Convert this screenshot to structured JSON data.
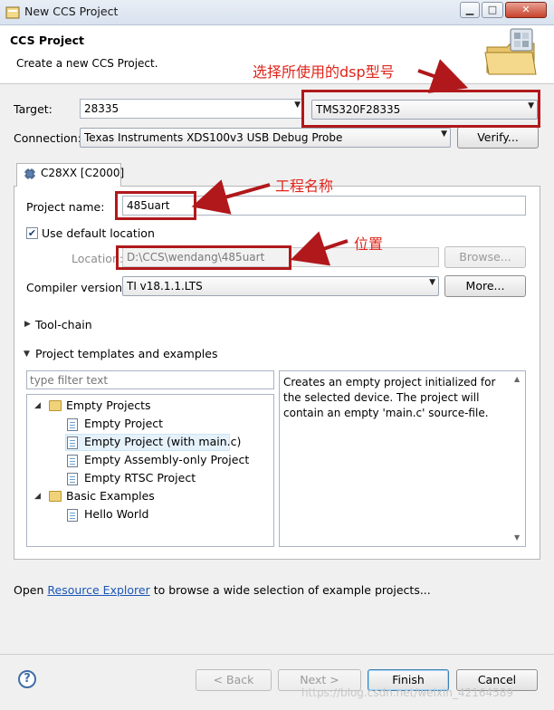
{
  "window": {
    "title": "New CCS Project",
    "buttons": {
      "minimize": "▁",
      "maximize": "□",
      "close": "✕"
    }
  },
  "header": {
    "title": "CCS Project",
    "subtitle": "Create a new CCS Project."
  },
  "form": {
    "target_label": "Target:",
    "target_family_value": "28335",
    "target_device_value": "TMS320F28335",
    "connection_label": "Connection:",
    "connection_value": "Texas Instruments XDS100v3 USB Debug Probe",
    "verify_button": "Verify..."
  },
  "tab": {
    "label": "C28XX [C2000]"
  },
  "project": {
    "name_label": "Project name:",
    "name_value": "485uart",
    "use_default_location_label": "Use default location",
    "use_default_location_checked": true,
    "location_label": "Location:",
    "location_value": "D:\\CCS\\wendang\\485uart",
    "browse_button": "Browse...",
    "compiler_label": "Compiler version:",
    "compiler_value": "TI v18.1.1.LTS",
    "more_button": "More..."
  },
  "sections": {
    "toolchain": "Tool-chain",
    "templates": "Project templates and examples"
  },
  "templates": {
    "filter_placeholder": "type filter text",
    "tree": [
      {
        "label": "Empty Projects",
        "level": 0,
        "type": "folder",
        "expanded": true
      },
      {
        "label": "Empty Project",
        "level": 1,
        "type": "file"
      },
      {
        "label": "Empty Project (with main.c)",
        "level": 1,
        "type": "file",
        "selected": true
      },
      {
        "label": "Empty Assembly-only Project",
        "level": 1,
        "type": "file"
      },
      {
        "label": "Empty RTSC Project",
        "level": 1,
        "type": "file"
      },
      {
        "label": "Basic Examples",
        "level": 0,
        "type": "folder",
        "expanded": true
      },
      {
        "label": "Hello World",
        "level": 1,
        "type": "file"
      }
    ],
    "description": "Creates an empty project initialized for the selected device. The project will contain an empty 'main.c' source-file."
  },
  "resource": {
    "prefix": "Open ",
    "link": "Resource Explorer",
    "suffix": " to browse a wide selection of example projects..."
  },
  "footer": {
    "help": "?",
    "back": "< Back",
    "next": "Next >",
    "finish": "Finish",
    "cancel": "Cancel"
  },
  "annotations": {
    "dsp_model": "选择所使用的dsp型号",
    "project_name": "工程名称",
    "location": "位置",
    "color": "#e0251b"
  },
  "watermark": "https://blog.csdn.net/weixin_42164589"
}
